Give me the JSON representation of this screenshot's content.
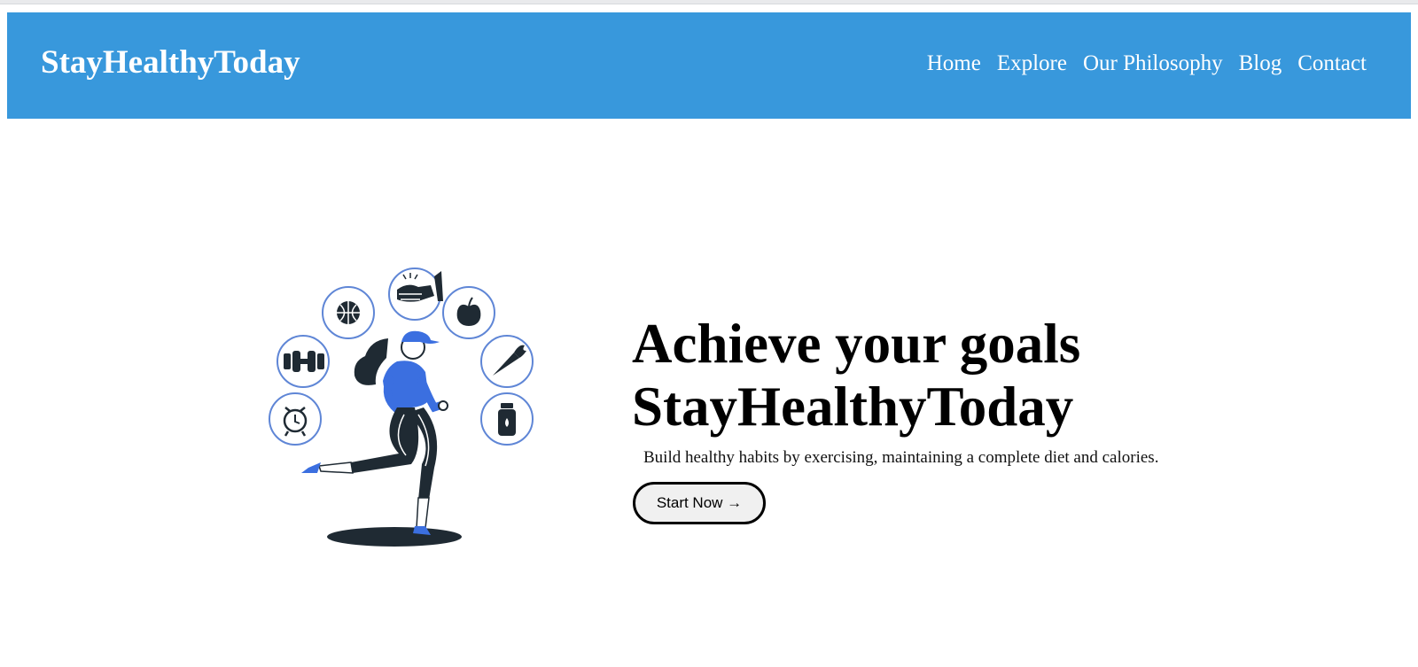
{
  "nav": {
    "brand": "StayHealthyToday",
    "links": [
      "Home",
      "Explore",
      "Our Philosophy",
      "Blog",
      "Contact"
    ]
  },
  "hero": {
    "title_line1": "Achieve your goals",
    "title_line2": "StayHealthyToday",
    "subtitle": "Build healthy habits by exercising, maintaining a complete diet and calories.",
    "cta_label": "Start Now →"
  },
  "colors": {
    "navbar": "#3898dc",
    "accent": "#3b6fe0",
    "ink": "#1f2a33"
  },
  "illustration": {
    "icons": [
      "basketball-icon",
      "clapping-hands-icon",
      "apple-icon",
      "dumbbell-icon",
      "carrot-icon",
      "alarm-clock-icon",
      "water-bottle-icon"
    ]
  }
}
